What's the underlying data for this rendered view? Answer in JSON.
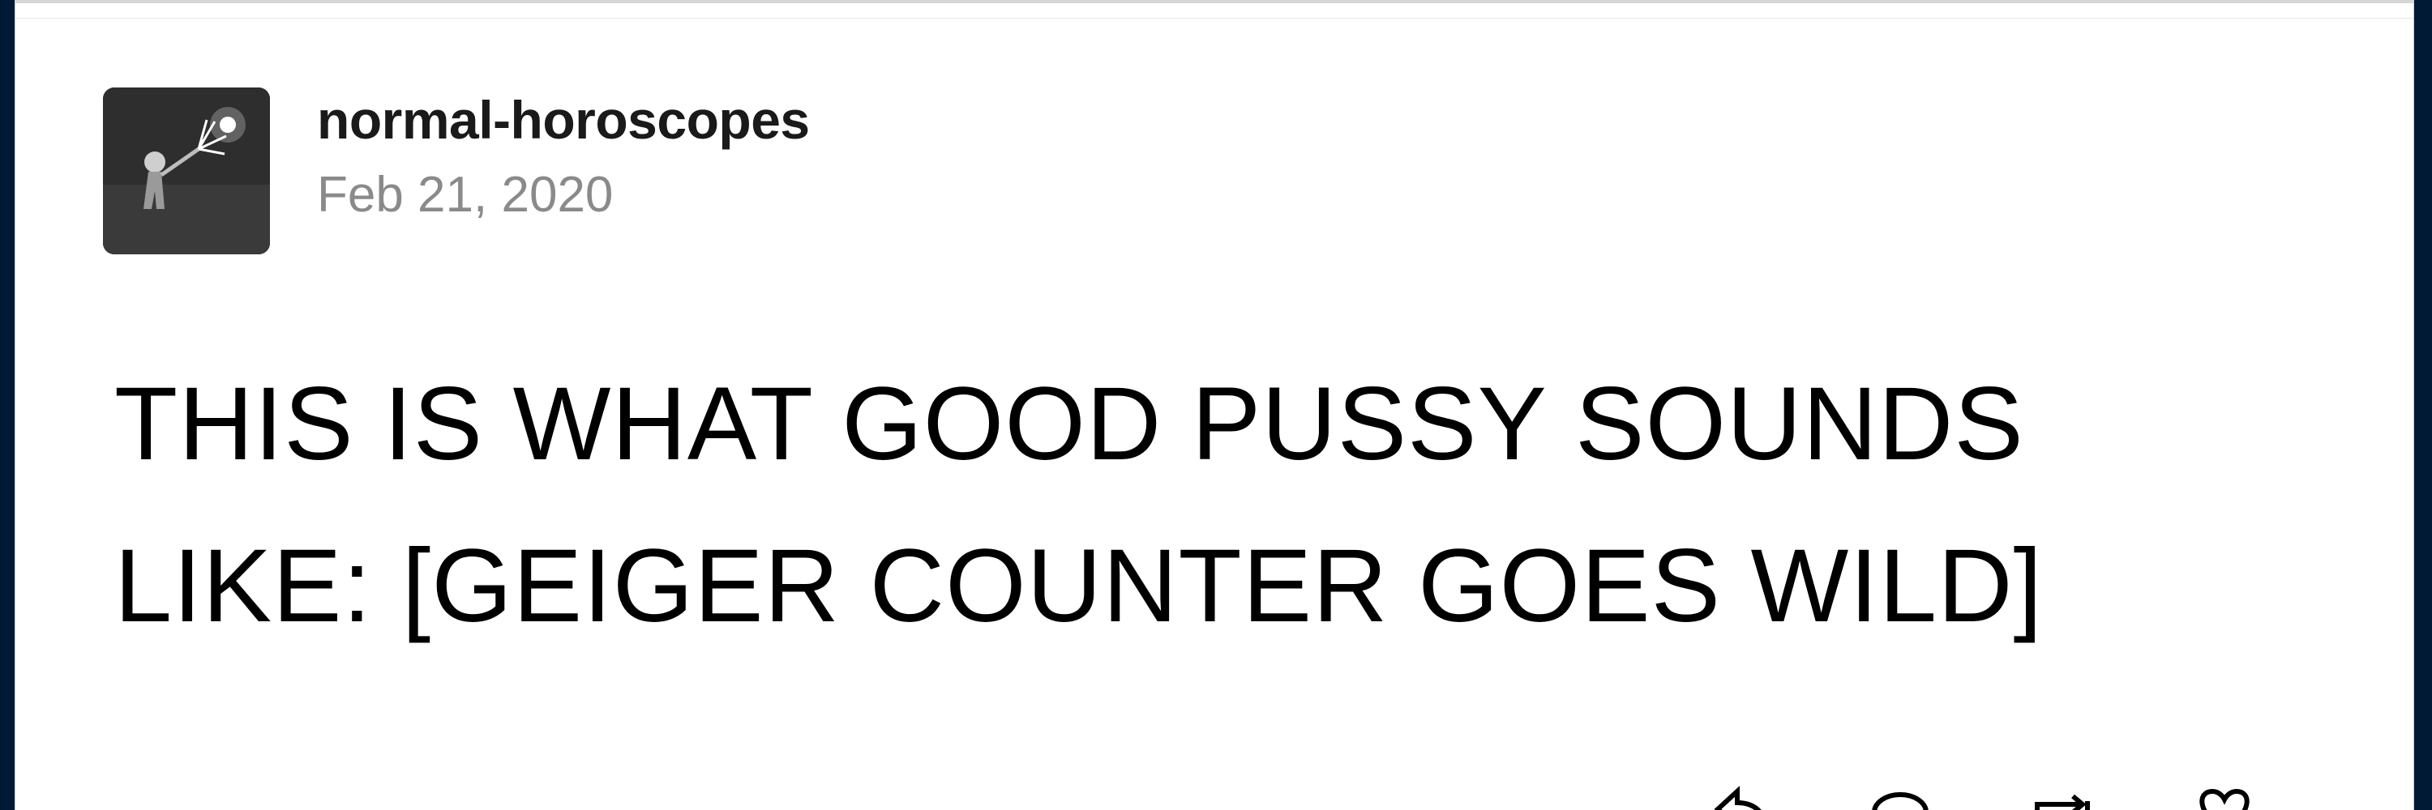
{
  "post": {
    "username": "normal-horoscopes",
    "date": "Feb 21, 2020",
    "body_line_1": "THIS IS WHAT GOOD PUSSY SOUNDS",
    "body_line_2": "LIKE: [GEIGER COUNTER GOES WILD]"
  },
  "icons": {
    "avatar": "avatar-image",
    "footer": [
      "share-icon",
      "reply-icon",
      "reblog-icon",
      "like-icon"
    ]
  },
  "colors": {
    "frame": "#001935",
    "card": "#ffffff",
    "username": "#1a1a1a",
    "date": "#8a8a8a",
    "body": "#000000"
  }
}
